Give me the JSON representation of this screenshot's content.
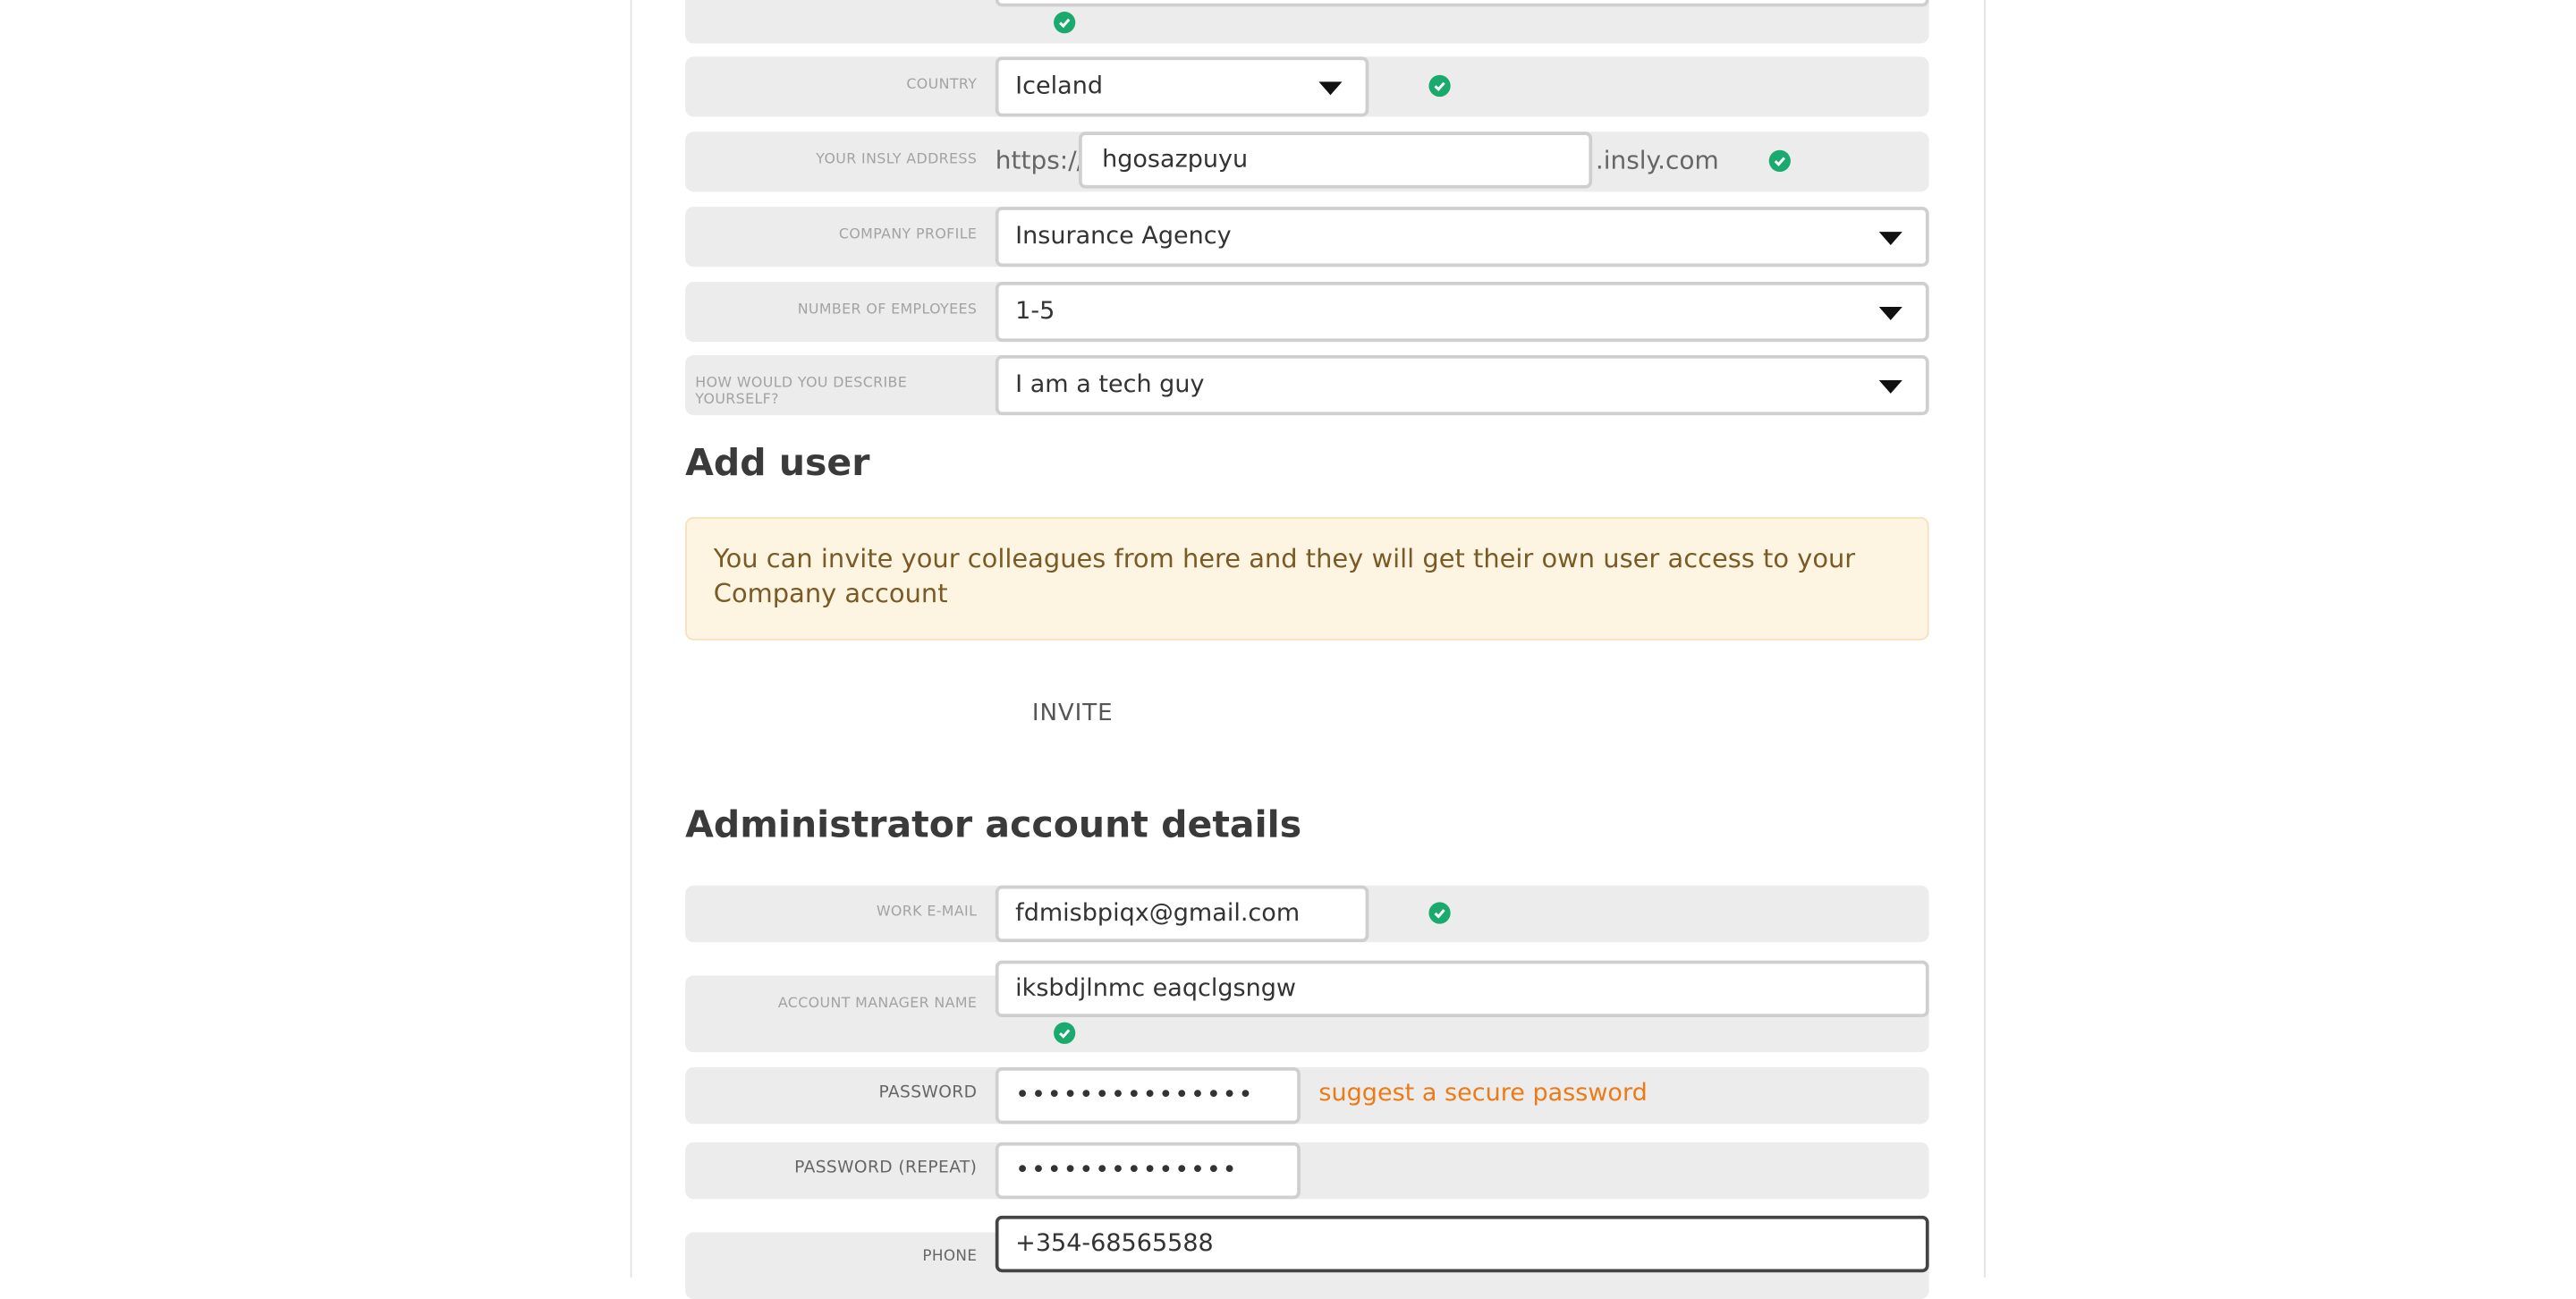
{
  "company_section": {
    "country_label": "Country",
    "country_value": "Iceland",
    "address_label": "Your Insly address",
    "address_prefix": "https://",
    "address_value": "hgosazpuyu",
    "address_suffix": ".insly.com",
    "profile_label": "Company profile",
    "profile_value": "Insurance Agency",
    "employees_label": "Number of employees",
    "employees_value": "1-5",
    "describe_label": "How would you describe yourself?",
    "describe_value": "I am a tech guy"
  },
  "add_user": {
    "title": "Add user",
    "notice": "You can invite your colleagues from here and they will get their own user access to your Company account",
    "invite_label": "INVITE"
  },
  "admin": {
    "title": "Administrator account details",
    "email_label": "Work e-mail",
    "email_value": "fdmisbpiqx@gmail.com",
    "manager_label": "Account manager name",
    "manager_value": "iksbdjlnmc eaqclgsngw",
    "password_label": "Password",
    "password_value": "•••••••••••••••",
    "suggest_link": "suggest a secure password",
    "password_repeat_label": "Password (repeat)",
    "password_repeat_value": "••••••••••••••",
    "phone_label": "Phone",
    "phone_value": "+354-68565588"
  },
  "colors": {
    "check_green": "#1aaa6e",
    "row_bg": "#ececec",
    "notice_bg": "#fdf5e2",
    "suggest_orange": "#ee7a16"
  }
}
